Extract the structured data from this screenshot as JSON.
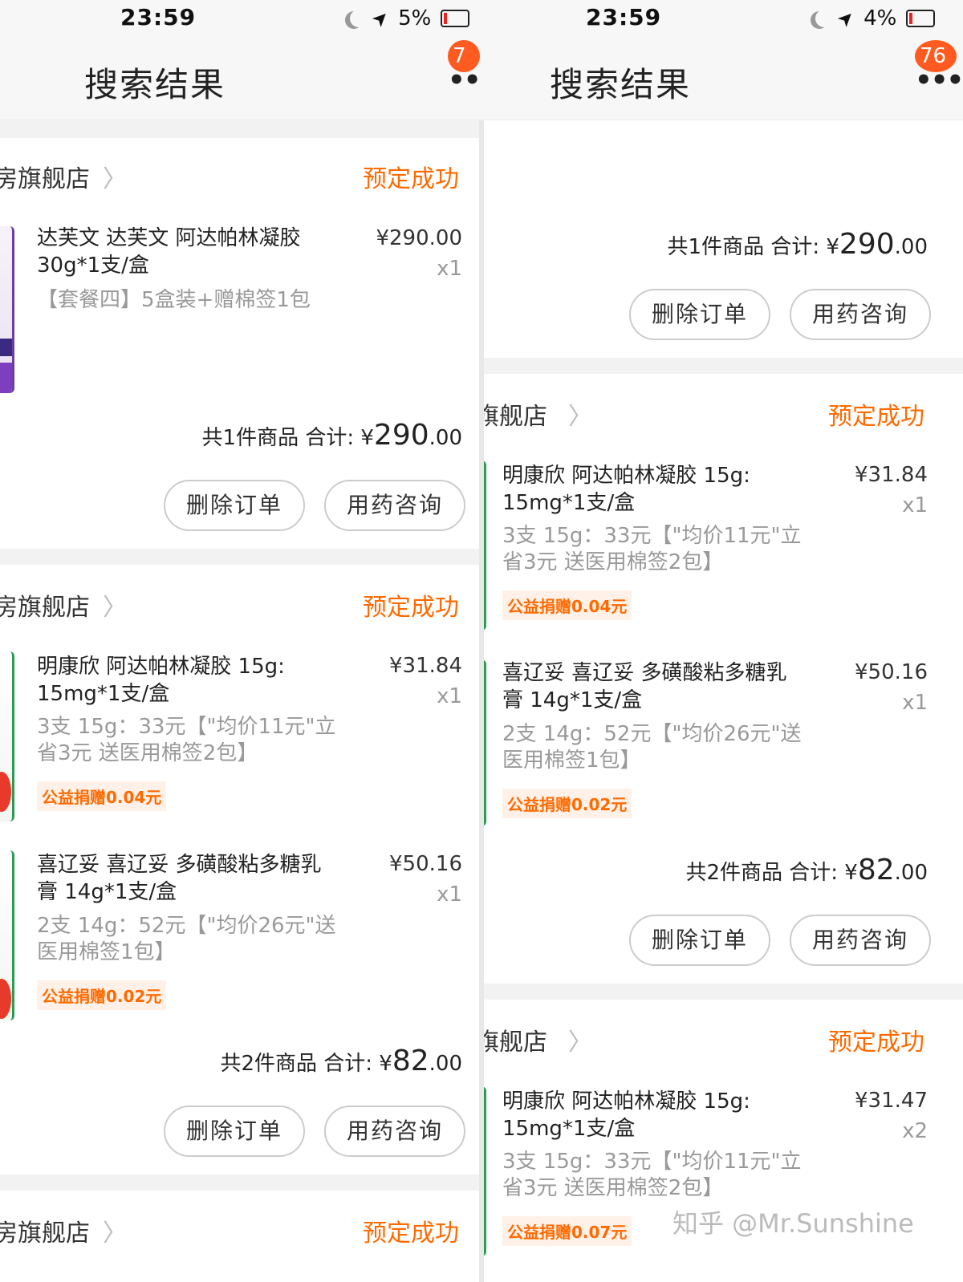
{
  "left": {
    "time": "23:59",
    "battery": "5%",
    "title": "搜索结果",
    "badge": "7",
    "orders": [
      {
        "shop": "房旗舰店",
        "status": "预定成功",
        "items": [
          {
            "title": "达芙文 达芙文 阿达帕林凝胶 30g*1支/盒",
            "spec": "【套餐四】5盒装+赠棉签1包",
            "price": "¥290.00",
            "qty": "x1",
            "donation": ""
          }
        ],
        "summary_prefix": "共1件商品 合计: ¥",
        "summary_big": "290",
        "summary_small": ".00",
        "btn_delete": "删除订单",
        "btn_consult": "用药咨询"
      },
      {
        "shop": "房旗舰店",
        "status": "预定成功",
        "items": [
          {
            "title": "明康欣 阿达帕林凝胶 15g: 15mg*1支/盒",
            "spec": "3支 15g：33元【\"均价11元\"立省3元 送医用棉签2包】",
            "price": "¥31.84",
            "qty": "x1",
            "donation": "公益捐赠0.04元"
          },
          {
            "title": "喜辽妥 喜辽妥 多磺酸粘多糖乳膏 14g*1支/盒",
            "spec": "2支 14g：52元【\"均价26元\"送医用棉签1包】",
            "price": "¥50.16",
            "qty": "x1",
            "donation": "公益捐赠0.02元"
          }
        ],
        "summary_prefix": "共2件商品 合计: ¥",
        "summary_big": "82",
        "summary_small": ".00",
        "btn_delete": "删除订单",
        "btn_consult": "用药咨询"
      },
      {
        "shop": "房旗舰店",
        "status": "预定成功"
      }
    ]
  },
  "right": {
    "time": "23:59",
    "battery": "4%",
    "title": "搜索结果",
    "badge": "76",
    "top_summary": {
      "summary_prefix": "共1件商品 合计: ¥",
      "summary_big": "290",
      "summary_small": ".00",
      "btn_delete": "删除订单",
      "btn_consult": "用药咨询"
    },
    "orders": [
      {
        "shop": "旗舰店",
        "status": "预定成功",
        "items": [
          {
            "title": "明康欣 阿达帕林凝胶 15g: 15mg*1支/盒",
            "spec": "3支 15g：33元【\"均价11元\"立省3元 送医用棉签2包】",
            "price": "¥31.84",
            "qty": "x1",
            "donation": "公益捐赠0.04元"
          },
          {
            "title": "喜辽妥 喜辽妥 多磺酸粘多糖乳膏 14g*1支/盒",
            "spec": "2支 14g：52元【\"均价26元\"送医用棉签1包】",
            "price": "¥50.16",
            "qty": "x1",
            "donation": "公益捐赠0.02元"
          }
        ],
        "summary_prefix": "共2件商品 合计: ¥",
        "summary_big": "82",
        "summary_small": ".00",
        "btn_delete": "删除订单",
        "btn_consult": "用药咨询"
      },
      {
        "shop": "旗舰店",
        "status": "预定成功",
        "items": [
          {
            "title": "明康欣 阿达帕林凝胶 15g: 15mg*1支/盒",
            "spec": "3支 15g：33元【\"均价11元\"立省3元 送医用棉签2包】",
            "price": "¥31.47",
            "qty": "x2",
            "donation": "公益捐赠0.07元"
          }
        ]
      }
    ]
  },
  "watermark": "知乎 @Mr.Sunshine",
  "colors": {
    "accent": "#ff6a00",
    "badge": "#ff5a1f",
    "gap": "#f2f2f2"
  }
}
